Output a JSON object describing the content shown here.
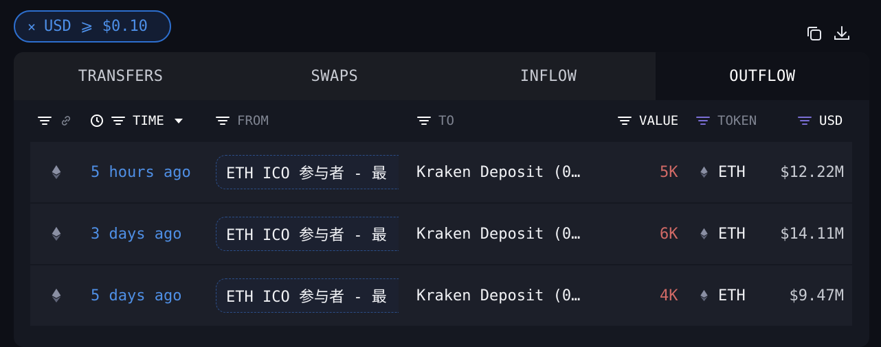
{
  "filter": {
    "close_symbol": "×",
    "label": "USD ⩾ $0.10"
  },
  "toolbar": {
    "copy_icon": "copy-icon",
    "download_icon": "download-icon"
  },
  "tabs": [
    {
      "label": "TRANSFERS",
      "active": false
    },
    {
      "label": "SWAPS",
      "active": false
    },
    {
      "label": "INFLOW",
      "active": false
    },
    {
      "label": "OUTFLOW",
      "active": true
    }
  ],
  "columns": {
    "time": "TIME",
    "from": "FROM",
    "to": "TO",
    "value": "VALUE",
    "token": "TOKEN",
    "usd": "USD"
  },
  "rows": [
    {
      "time": "5 hours ago",
      "from": "ETH ICO 参与者 - 最",
      "to": "Kraken Deposit (0…",
      "value": "5K",
      "token": "ETH",
      "usd": "$12.22M"
    },
    {
      "time": "3 days ago",
      "from": "ETH ICO 参与者 - 最",
      "to": "Kraken Deposit (0…",
      "value": "6K",
      "token": "ETH",
      "usd": "$14.11M"
    },
    {
      "time": "5 days ago",
      "from": "ETH ICO 参与者 - 最",
      "to": "Kraken Deposit (0…",
      "value": "4K",
      "token": "ETH",
      "usd": "$9.47M"
    }
  ],
  "colors": {
    "accent": "#4d8fe8",
    "value_red": "#d26a66",
    "token_filter_purple": "#7b6fd6"
  }
}
